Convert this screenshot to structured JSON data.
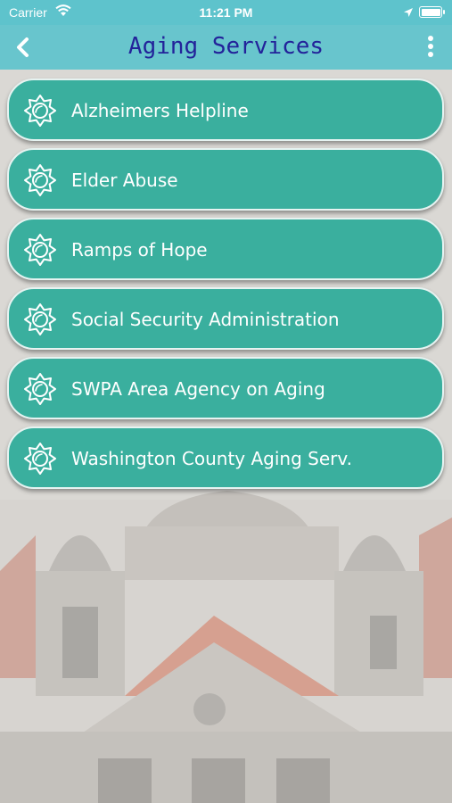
{
  "status_bar": {
    "carrier": "Carrier",
    "time": "11:21 PM",
    "battery_level": 1.0,
    "wifi_icon": "wifi-icon",
    "location_icon": "location-arrow-icon"
  },
  "nav": {
    "title": "Aging Services",
    "back_icon": "chevron-left-icon",
    "more_icon": "more-vertical-icon"
  },
  "list": {
    "item_icon": "sun-gear-icon",
    "items": [
      {
        "label": "Alzheimers Helpline"
      },
      {
        "label": "Elder Abuse"
      },
      {
        "label": "Ramps of Hope"
      },
      {
        "label": "Social Security Administration"
      },
      {
        "label": "SWPA Area Agency on Aging"
      },
      {
        "label": "Washington County Aging Serv."
      }
    ]
  },
  "colors": {
    "bar": "#5ec3cc",
    "title_text": "#23239a",
    "item_fill": "#3aaf9e",
    "item_border": "#e6f3f1"
  }
}
